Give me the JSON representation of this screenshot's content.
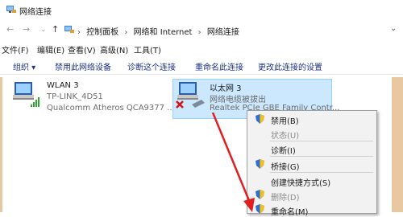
{
  "window": {
    "title": "网络连接"
  },
  "nav": {
    "back": "←",
    "forward": "→",
    "dropdown": "⌄",
    "up": "↑"
  },
  "breadcrumb": {
    "items": [
      "控制面板",
      "网络和 Internet",
      "网络连接"
    ],
    "sep": "›",
    "dropdown": "⌄"
  },
  "menubar": {
    "items": [
      "文件(F)",
      "编辑(E)",
      "查看(V)",
      "高级(N)",
      "工具(T)"
    ]
  },
  "commandbar": {
    "items": [
      "组织 ▾",
      "禁用此网络设备",
      "诊断这个连接",
      "重命名此连接",
      "更改此连接的设置"
    ]
  },
  "connections": [
    {
      "name": "WLAN 3",
      "status": "TP-LINK_4D51",
      "adapter": "Qualcomm Atheros QCA9377 ..."
    },
    {
      "name": "以太网 3",
      "status": "网络电缆被拔出",
      "adapter": "Realtek PCIe GBE Family Contr..."
    }
  ],
  "context_menu": {
    "items": [
      {
        "label": "禁用(B)",
        "shield": true,
        "disabled": false
      },
      {
        "label": "状态(U)",
        "shield": false,
        "disabled": true
      },
      {
        "label": "诊断(I)",
        "shield": false,
        "disabled": false
      },
      {
        "label": "桥接(G)",
        "shield": true,
        "disabled": false
      },
      {
        "label": "创建快捷方式(S)",
        "shield": false,
        "disabled": false
      },
      {
        "label": "删除(D)",
        "shield": true,
        "disabled": true
      },
      {
        "label": "重命名(M)",
        "shield": true,
        "disabled": false
      }
    ]
  },
  "colors": {
    "selection": "#cce8ff",
    "arrow": "#e02020",
    "command_text": "#1e3287",
    "frame": "#e8c8a0"
  }
}
